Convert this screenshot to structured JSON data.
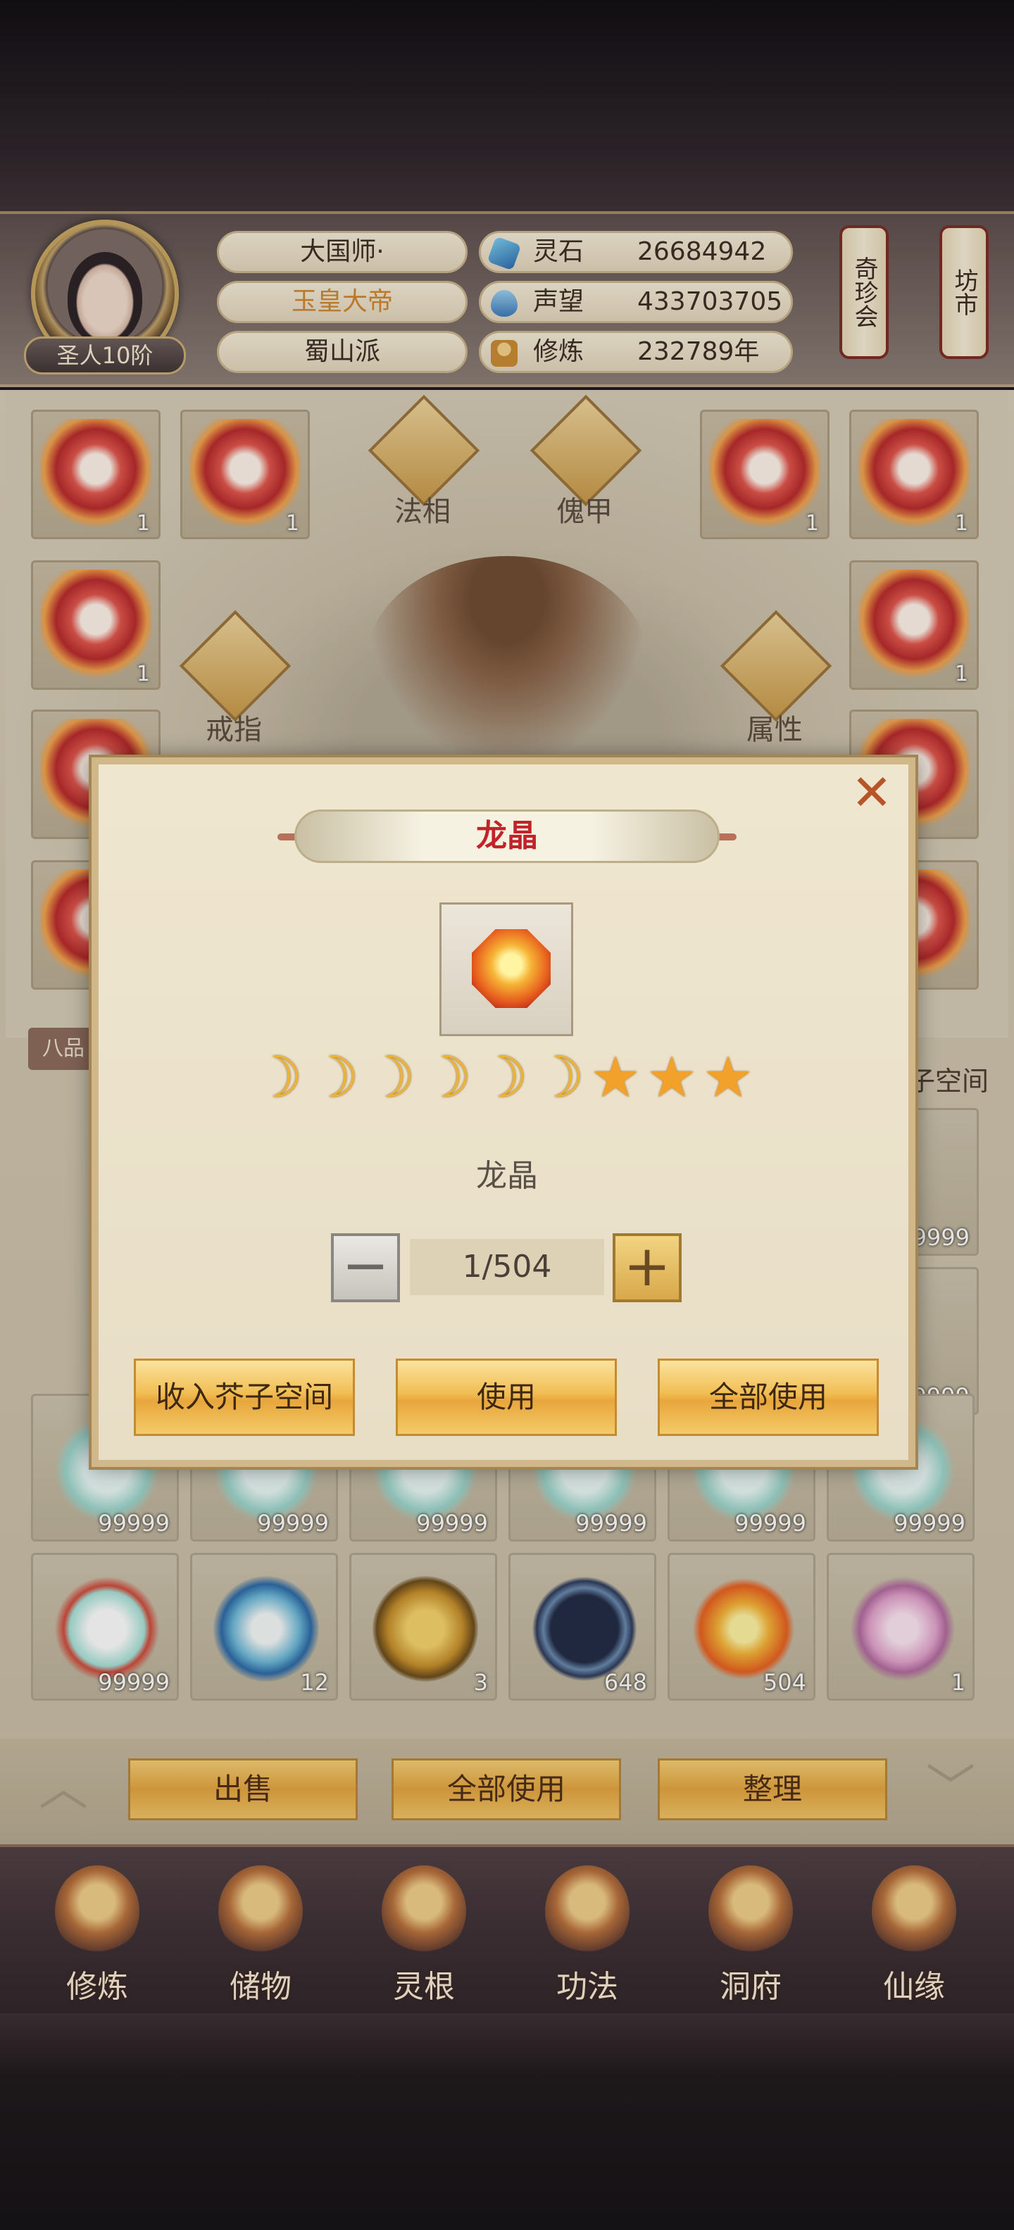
{
  "header": {
    "rank_badge": "圣人10阶",
    "title": "大国师·",
    "rank": "玉皇大帝",
    "sect": "蜀山派",
    "stats": [
      {
        "label": "灵石",
        "value": "26684942",
        "icon": "spirit-stone-icon"
      },
      {
        "label": "声望",
        "value": "433703705",
        "icon": "reputation-icon"
      },
      {
        "label": "修炼",
        "value": "232789年",
        "icon": "cultivation-icon"
      }
    ],
    "scroll_buttons": [
      "奇珍会",
      "坊市"
    ]
  },
  "equipment": {
    "slot_labels": [
      "法相",
      "傀甲",
      "戒指",
      "属性"
    ],
    "slot_qty": "1"
  },
  "bag": {
    "tab_label": "八品",
    "space_label": "子空间",
    "quantities_row1": [
      "99999",
      "99999",
      "99999",
      "99999",
      "99999",
      "99999"
    ],
    "quantities_row2": [
      "99999",
      "12",
      "3",
      "648",
      "504",
      "1"
    ],
    "side_quantities": [
      "9999",
      "9999"
    ]
  },
  "toolbar": {
    "sell": "出售",
    "use_all": "全部使用",
    "sort": "整理",
    "prev_arrow": "︿",
    "next_arrow": "﹀"
  },
  "nav": {
    "items": [
      {
        "label": "修炼",
        "icon": "cultivate-nav-icon"
      },
      {
        "label": "储物",
        "icon": "storage-bag-icon"
      },
      {
        "label": "灵根",
        "icon": "spirit-root-icon"
      },
      {
        "label": "功法",
        "icon": "technique-book-icon"
      },
      {
        "label": "洞府",
        "icon": "cave-dwelling-icon"
      },
      {
        "label": "仙缘",
        "icon": "immortal-fate-icon"
      }
    ]
  },
  "modal": {
    "title": "龙晶",
    "item_name": "龙晶",
    "item_icon": "dragon-crystal-icon",
    "grade": {
      "moons": 6,
      "stars": 3
    },
    "quantity": "1/504",
    "minus": "−",
    "plus": "+",
    "close": "✕",
    "buttons": {
      "store": "收入芥子空间",
      "use": "使用",
      "use_all": "全部使用"
    }
  }
}
